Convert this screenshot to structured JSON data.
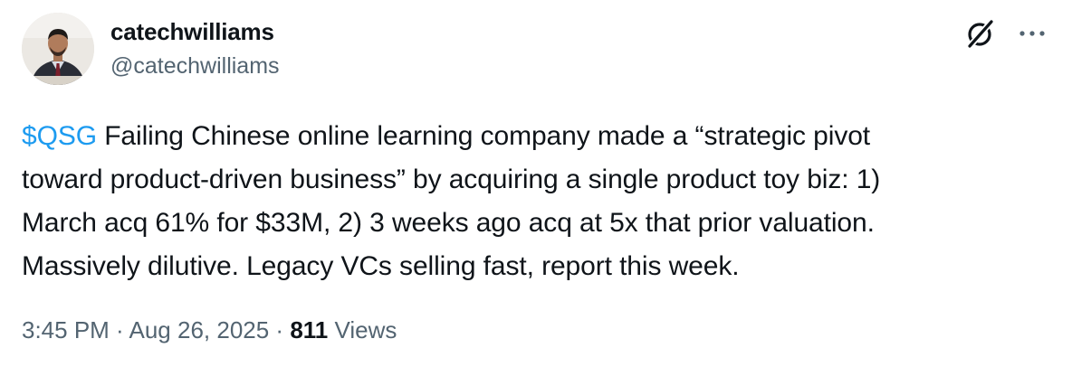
{
  "author": {
    "display_name": "catechwilliams",
    "handle": "@catechwilliams"
  },
  "actions": {
    "grok_icon": "grok-icon",
    "more_icon": "more-horizontal-icon"
  },
  "tweet": {
    "cashtag": "$QSG",
    "lines": [
      " Failing Chinese online learning company made a “strategic pivot",
      "toward product-driven business” by acquiring a single product toy biz: 1)",
      "March acq 61% for $33M, 2) 3 weeks ago acq at 5x that prior valuation.",
      "Massively dilutive. Legacy VCs selling fast, report this week."
    ]
  },
  "meta": {
    "time": "3:45 PM",
    "separator1": " · ",
    "date": "Aug 26, 2025",
    "separator2": " · ",
    "views_count": "811",
    "views_label": " Views"
  },
  "colors": {
    "text": "#0f1419",
    "secondary": "#536471",
    "link": "#1d9bf0"
  }
}
